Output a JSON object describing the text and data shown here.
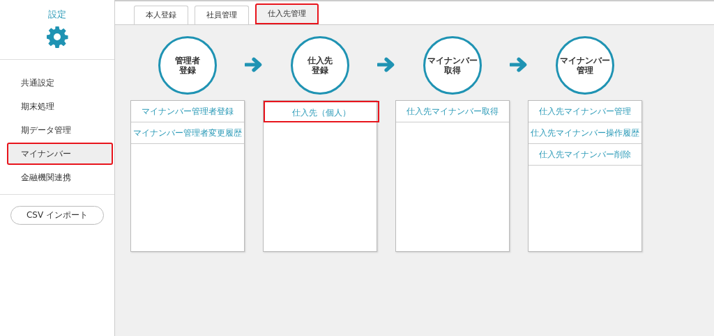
{
  "sidebar": {
    "title": "設定",
    "items": [
      {
        "label": "共通設定",
        "selected": false,
        "highlighted": false
      },
      {
        "label": "期末処理",
        "selected": false,
        "highlighted": false
      },
      {
        "label": "期データ管理",
        "selected": false,
        "highlighted": false
      },
      {
        "label": "マイナンバー",
        "selected": true,
        "highlighted": true
      },
      {
        "label": "金融機関連携",
        "selected": false,
        "highlighted": false
      }
    ],
    "import_button": "CSV インポート"
  },
  "tabs": [
    {
      "label": "本人登録",
      "selected": false,
      "highlighted": false
    },
    {
      "label": "社員管理",
      "selected": false,
      "highlighted": false
    },
    {
      "label": "仕入先管理",
      "selected": true,
      "highlighted": true
    }
  ],
  "steps": [
    {
      "label_lines": [
        "管理者",
        "登録"
      ],
      "links": [
        {
          "label": "マイナンバー管理者登録",
          "highlighted": false
        },
        {
          "label": "マイナンバー管理者変更履歴",
          "highlighted": false
        }
      ]
    },
    {
      "label_lines": [
        "仕入先",
        "登録"
      ],
      "links": [
        {
          "label": "仕入先（個人）",
          "highlighted": true
        }
      ]
    },
    {
      "label_lines": [
        "マイナンバー",
        "取得"
      ],
      "links": [
        {
          "label": "仕入先マイナンバー取得",
          "highlighted": false
        }
      ]
    },
    {
      "label_lines": [
        "マイナンバー",
        "管理"
      ],
      "links": [
        {
          "label": "仕入先マイナンバー管理",
          "highlighted": false
        },
        {
          "label": "仕入先マイナンバー操作履歴",
          "highlighted": false
        },
        {
          "label": "仕入先マイナンバー削除",
          "highlighted": false
        }
      ]
    }
  ]
}
